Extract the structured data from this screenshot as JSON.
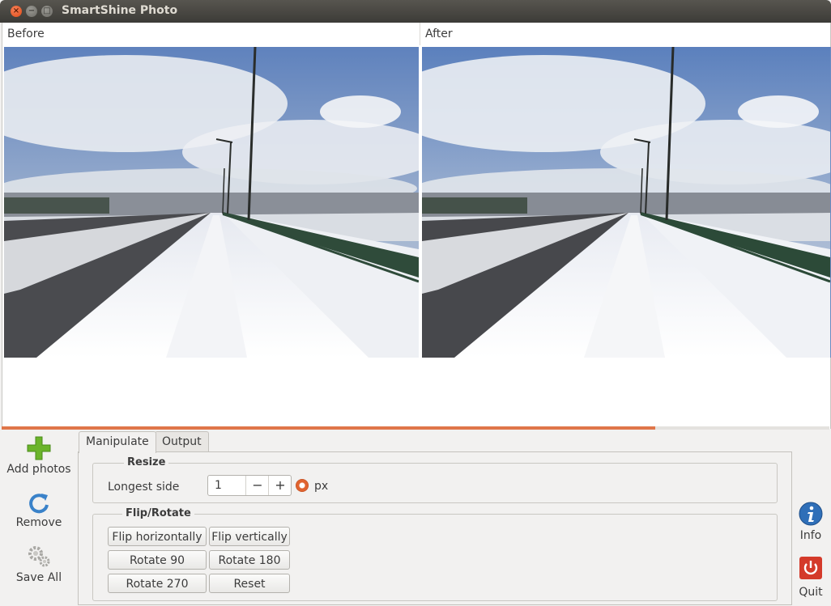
{
  "window": {
    "title": "SmartShine Photo"
  },
  "panels": {
    "before_label": "Before",
    "after_label": "After"
  },
  "progress": {
    "percent": 79
  },
  "toolbar": {
    "add_label": "Add photos",
    "remove_label": "Remove",
    "save_label": "Save All"
  },
  "tabs": [
    {
      "label": "Manipulate",
      "active": true
    },
    {
      "label": "Output",
      "active": false
    }
  ],
  "resize": {
    "title": "Resize",
    "longest_side_label": "Longest side",
    "value": "1",
    "minus": "−",
    "plus": "+",
    "unit": "px"
  },
  "flip": {
    "title": "Flip/Rotate",
    "flip_h": "Flip horizontally",
    "flip_v": "Flip vertically",
    "rot90": "Rotate 90",
    "rot180": "Rotate 180",
    "rot270": "Rotate 270",
    "reset": "Reset"
  },
  "side": {
    "info_label": "Info",
    "quit_label": "Quit"
  },
  "colors": {
    "accent": "#e0764a",
    "info_blue": "#2f6fb8",
    "quit_red": "#d43a2a",
    "add_green": "#6bb42b"
  }
}
